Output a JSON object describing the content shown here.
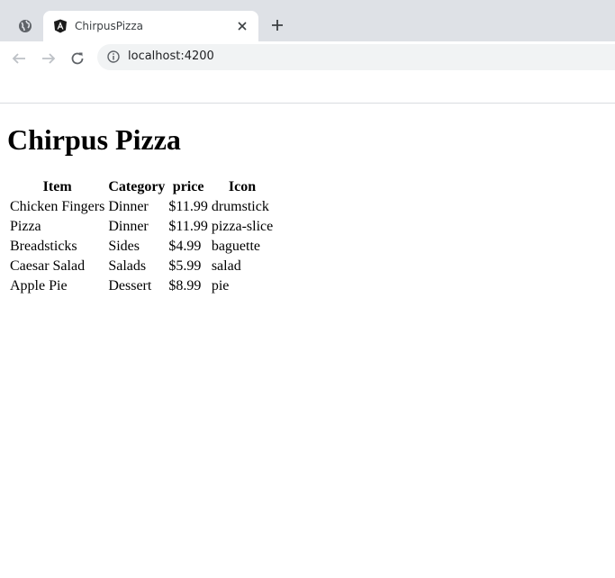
{
  "browser": {
    "tab": {
      "title": "ChirpusPizza",
      "favicon": "angular-icon"
    },
    "address_bar": {
      "url": "localhost:4200"
    },
    "icons": {
      "back": "arrow-left-icon",
      "forward": "arrow-right-icon",
      "reload": "reload-icon",
      "info": "info-icon",
      "close": "close-icon",
      "new_tab": "plus-icon",
      "globe": "globe-icon"
    },
    "colors": {
      "tabstrip": "#dee1e6",
      "omnibox": "#f1f3f4"
    }
  },
  "page": {
    "heading": "Chirpus Pizza",
    "table": {
      "headers": [
        "Item",
        "Category",
        "price",
        "Icon"
      ],
      "rows": [
        [
          "Chicken Fingers",
          "Dinner",
          "$11.99",
          "drumstick"
        ],
        [
          "Pizza",
          "Dinner",
          "$11.99",
          "pizza-slice"
        ],
        [
          "Breadsticks",
          "Sides",
          "$4.99",
          "baguette"
        ],
        [
          "Caesar Salad",
          "Salads",
          "$5.99",
          "salad"
        ],
        [
          "Apple Pie",
          "Dessert",
          "$8.99",
          "pie"
        ]
      ]
    }
  }
}
